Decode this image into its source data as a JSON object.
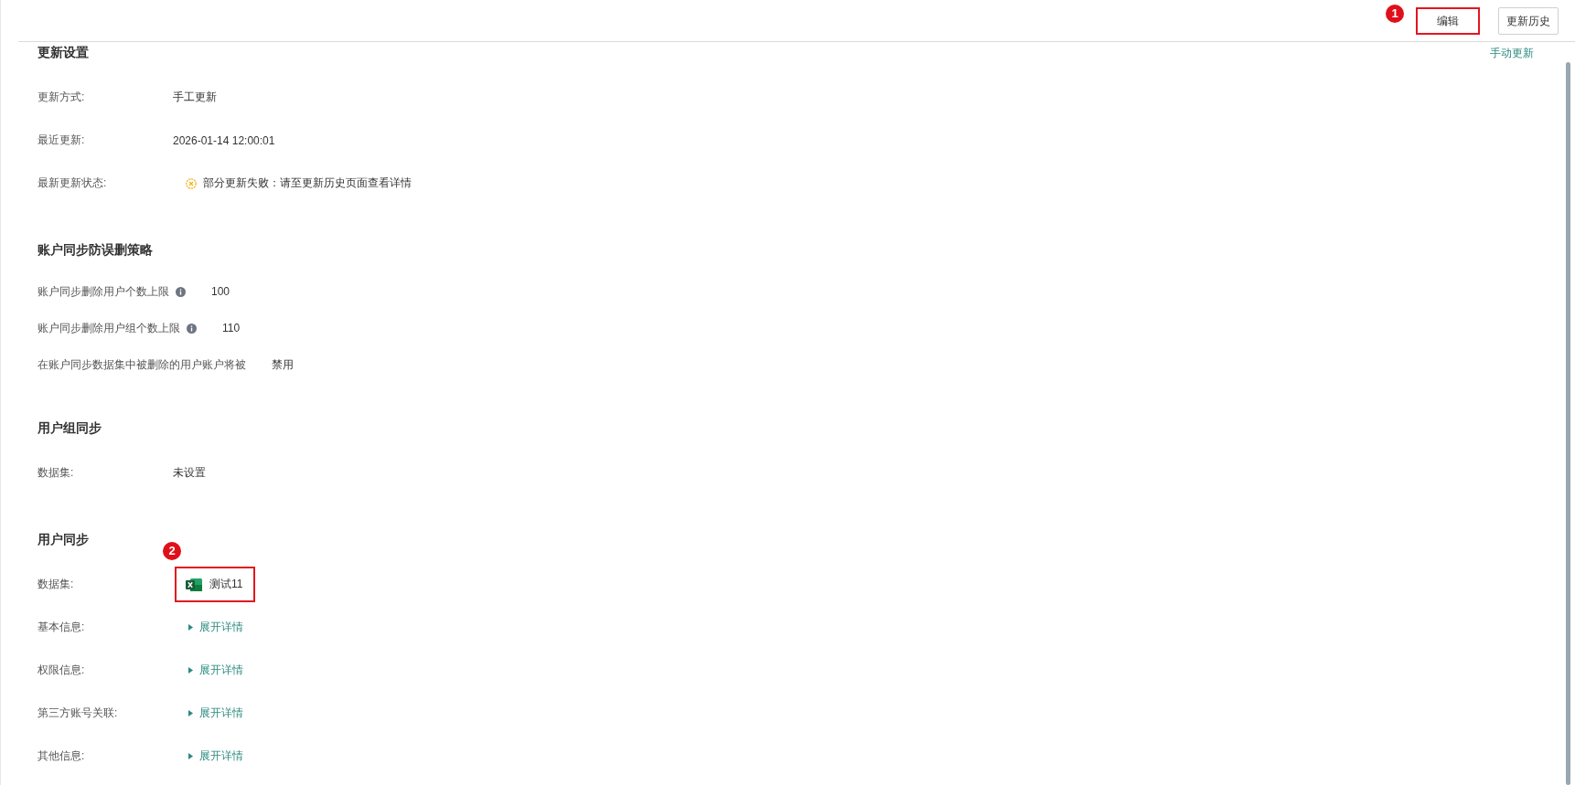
{
  "toolbar": {
    "buttons": [
      {
        "label": "编辑",
        "highlighted": true,
        "callout": "1"
      },
      {
        "label": "更新历史",
        "highlighted": false
      }
    ]
  },
  "sections": [
    {
      "title": "更新设置",
      "action": "手动更新",
      "rows": [
        {
          "kind": "field",
          "label": "更新方式:",
          "value": "手工更新"
        },
        {
          "kind": "field",
          "label": "最近更新:",
          "value": "2026-01-14 12:00:01"
        },
        {
          "kind": "status",
          "label": "最新更新状态:",
          "value": "部分更新失败：请至更新历史页面查看详情",
          "warning": true
        }
      ]
    },
    {
      "title": "账户同步防误删策略",
      "rows": [
        {
          "kind": "inline",
          "label": "账户同步删除用户个数上限",
          "info": true,
          "value": "100"
        },
        {
          "kind": "inline",
          "label": "账户同步删除用户组个数上限",
          "info": true,
          "value": "110"
        },
        {
          "kind": "inline",
          "label": "在账户同步数据集中被删除的用户账户将被",
          "info": false,
          "value": "禁用"
        }
      ]
    },
    {
      "title": "用户组同步",
      "rows": [
        {
          "kind": "field",
          "label": "数据集:",
          "value": "未设置"
        }
      ]
    },
    {
      "title": "用户同步",
      "rows": [
        {
          "kind": "dataset",
          "label": "数据集:",
          "value": "测试11",
          "highlighted": true,
          "callout": "2"
        },
        {
          "kind": "expand",
          "label": "基本信息:",
          "value": "展开详情",
          "expanded": false
        },
        {
          "kind": "expand",
          "label": "权限信息:",
          "value": "展开详情",
          "expanded": false
        },
        {
          "kind": "expand",
          "label": "第三方账号关联:",
          "value": "展开详情",
          "expanded": false
        },
        {
          "kind": "expand",
          "label": "其他信息:",
          "value": "展开详情",
          "expanded": false
        }
      ]
    }
  ]
}
